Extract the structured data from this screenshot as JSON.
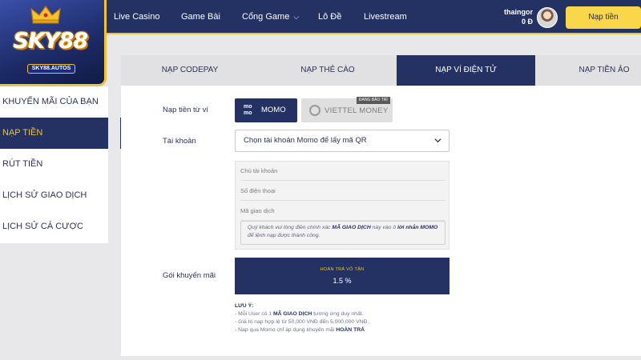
{
  "brand": {
    "name": "SKY88",
    "domain": "SKY88.AUTOS"
  },
  "nav": [
    "Live Casino",
    "Game Bài",
    "Cổng Game",
    "Lô Đề",
    "Livestream"
  ],
  "user": {
    "name": "thaingor",
    "balance": "0 Đ"
  },
  "header": {
    "deposit_button": "Nạp tiền"
  },
  "sidebar": {
    "items": [
      "KHUYẾN MÃI CỦA BẠN",
      "NẠP TIỀN",
      "RÚT TIỀN",
      "LỊCH SỬ GIAO DỊCH",
      "LỊCH SỬ CÁ CƯỢC"
    ],
    "active_index": 1
  },
  "tabs": [
    "NẠP CODEPAY",
    "NẠP THẺ CÀO",
    "NẠP VÍ ĐIỆN TỬ",
    "NẠP TIỀN ẢO"
  ],
  "active_tab_index": 2,
  "form": {
    "wallet_label": "Nạp tiền từ ví",
    "wallets": [
      {
        "icon_text": "mo mo",
        "label": "MOMO",
        "selected": true
      },
      {
        "label": "VIETTEL MONEY",
        "badge": "ĐANG BẢO TRÌ",
        "disabled": true
      }
    ],
    "account_label": "Tài khoản",
    "account_select": "Chọn tài khoản Momo để lấy mã QR",
    "fields": [
      "Chủ tài khoản",
      "Số điện thoại",
      "Mã giao dịch"
    ],
    "notice": {
      "part1": "Quý khách vui lòng điền chính xác ",
      "bold1": "MÃ GIAO DỊCH",
      "part2": " này vào ô ",
      "bold2": "lời nhắn MOMO",
      "part3": " để lệnh nạp được thành công."
    },
    "promo_label": "Gói khuyến mãi",
    "promo": {
      "name": "HOÀN TRẢ VÔ TẬN",
      "percent": "1.5 %"
    }
  },
  "notes": {
    "title": "LƯU Ý:",
    "line1_a": "- Mỗi User có 1 ",
    "line1_b": "MÃ GIAO DỊCH",
    "line1_c": " tương ứng duy nhất.",
    "line2": "- Giá trị nạp hợp lệ từ 50,000 VNĐ đến 5,000,000 VNĐ.",
    "line3_a": "- Nạp qua Momo chỉ áp dụng khuyến mãi ",
    "line3_b": "HOÀN TRẢ"
  },
  "colors": {
    "navy": "#233263",
    "gold": "#f1c232",
    "button_yellow": "#f9d64a"
  }
}
